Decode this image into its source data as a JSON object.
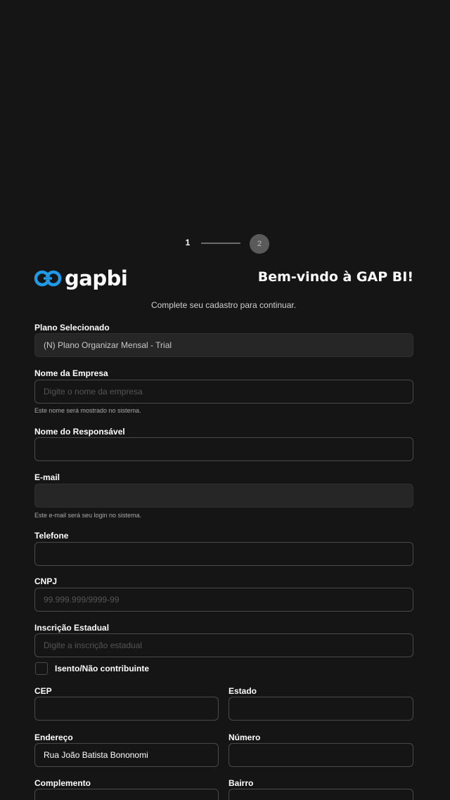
{
  "stepper": {
    "step1": "1",
    "step2": "2"
  },
  "header": {
    "logo_text": "gapbi",
    "welcome": "Bem-vindo à GAP BI!",
    "subtitle": "Complete seu cadastro para continuar."
  },
  "form": {
    "plano": {
      "label": "Plano Selecionado",
      "value": "(N) Plano Organizar Mensal - Trial"
    },
    "empresa": {
      "label": "Nome da Empresa",
      "placeholder": "Digite o nome da empresa",
      "hint": "Este nome será mostrado no sistema."
    },
    "responsavel": {
      "label": "Nome do Responsável",
      "value": ""
    },
    "email": {
      "label": "E-mail",
      "value": "",
      "hint": "Este e-mail será seu login no sistema."
    },
    "telefone": {
      "label": "Telefone",
      "value": ""
    },
    "cnpj": {
      "label": "CNPJ",
      "placeholder": "99.999.999/9999-99"
    },
    "inscricao": {
      "label": "Inscrição Estadual",
      "placeholder": "Digite a inscrição estadual"
    },
    "isento": {
      "label": "Isento/Não contribuinte",
      "checked": false
    },
    "cep": {
      "label": "CEP",
      "value": ""
    },
    "estado": {
      "label": "Estado",
      "value": ""
    },
    "endereco": {
      "label": "Endereço",
      "value": "Rua João Batista Bononomi"
    },
    "numero": {
      "label": "Número",
      "value": ""
    },
    "complemento": {
      "label": "Complemento",
      "value": ""
    },
    "bairro": {
      "label": "Bairro",
      "value": ""
    }
  }
}
